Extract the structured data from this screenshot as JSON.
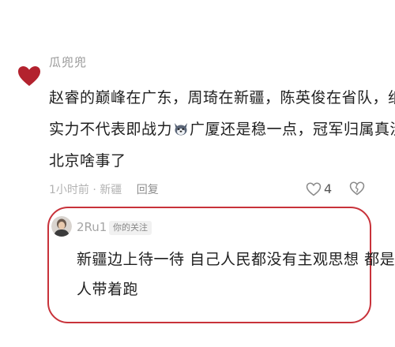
{
  "comment": {
    "username": "瓜兜兜",
    "text_lines": [
      "赵睿的巅峰在广东，周琦在新疆，陈英俊在省队，纸面",
      "实力不代表即战力",
      "广厦还是稳一点，冠军归属真没",
      "北京啥事了"
    ],
    "time_location": "1小时前 · 新疆",
    "reply_label": "回复",
    "like_count": "4",
    "avatar_icon": "heart-icon",
    "inline_emoji": "husky-dog-emoji-icon"
  },
  "reply": {
    "username": "2Ru1",
    "badge": "你的关注",
    "text_lines": [
      "新疆边上待一待 自己人民都没有主观思想 都是别",
      "人带着跑"
    ]
  },
  "colors": {
    "highlight": "#c8323a",
    "heart": "#b3222e",
    "text": "#1f1f1f",
    "meta": "#a8a8a8"
  }
}
